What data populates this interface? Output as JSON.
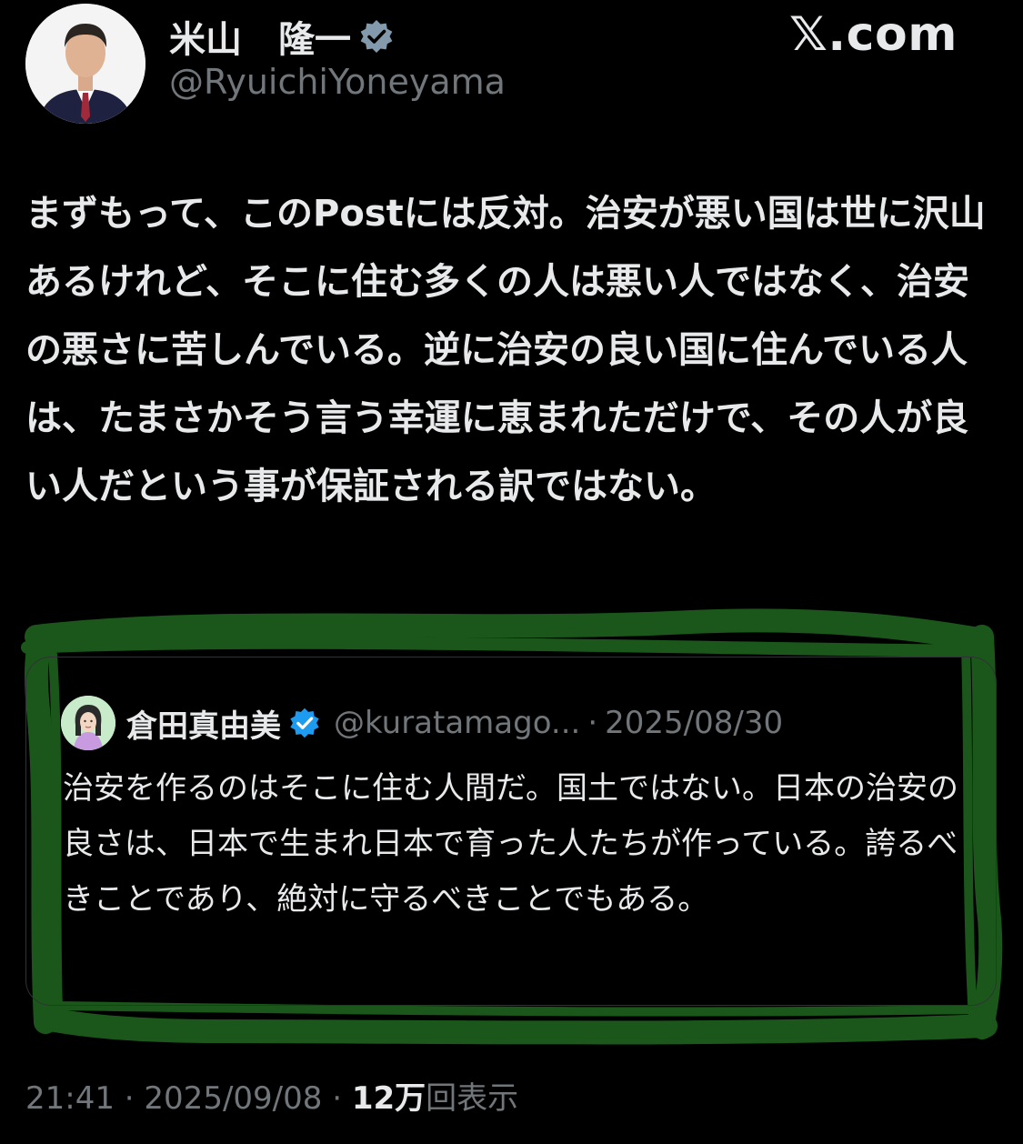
{
  "author": {
    "display_name": "米山　隆一",
    "handle": "@RyuichiYoneyama",
    "verified_color": "#829aab"
  },
  "site_logo": "𝕏.com",
  "tweet": {
    "text": "まずもって、このPostには反対。治安が悪い国は世に沢山あるけれど、そこに住む多くの人は悪い人ではなく、治安の悪さに苦しんでいる。逆に治安の良い国に住んでいる人は、たまさかそう言う幸運に恵まれただけで、その人が良い人だという事が保証される訳ではない。"
  },
  "quote": {
    "display_name": "倉田真由美",
    "handle": "@kuratamago...",
    "separator": "·",
    "date": "2025/08/30",
    "verified_color": "#1d9bf0",
    "text": "治安を作るのはそこに住む人間だ。国土ではない。日本の治安の良さは、日本で生まれ日本で育った人たちが作っている。誇るべきことであり、絶対に守るべきことでもある。"
  },
  "meta": {
    "time": "21:41",
    "sep1": " · ",
    "date": "2025/09/08",
    "sep2": " · ",
    "views_count": "12万",
    "views_label": "回表示"
  },
  "colors": {
    "background": "#000000",
    "text": "#e7e9ea",
    "muted": "#71767b",
    "highlight": "#1f5a1f"
  }
}
